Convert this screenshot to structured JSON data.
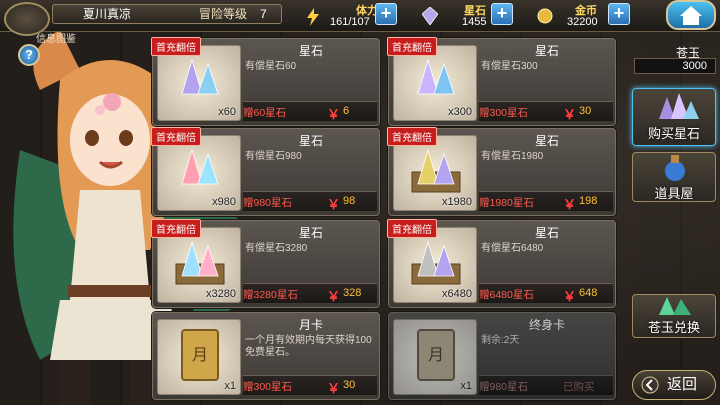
{
  "player": {
    "name": "夏川真凉",
    "level_label": "冒险等级",
    "level": "7"
  },
  "info_label": "信息图鉴",
  "help": "?",
  "resources": [
    {
      "label": "体力",
      "value": "161/107",
      "color": "#ffd866"
    },
    {
      "label": "星石",
      "value": "1455"
    },
    {
      "label": "金币",
      "value": "32200"
    }
  ],
  "plus": "+",
  "products": [
    {
      "badge": "首充翻倍",
      "title": "星石",
      "desc": "有偿星石60",
      "qty": "x60",
      "bonus": "赠60星石",
      "price": "6"
    },
    {
      "badge": "首充翻倍",
      "title": "星石",
      "desc": "有偿星石300",
      "qty": "x300",
      "bonus": "赠300星石",
      "price": "30"
    },
    {
      "badge": "首充翻倍",
      "title": "星石",
      "desc": "有偿星石980",
      "qty": "x980",
      "bonus": "赠980星石",
      "price": "98"
    },
    {
      "badge": "首充翻倍",
      "title": "星石",
      "desc": "有偿星石1980",
      "qty": "x1980",
      "bonus": "赠1980星石",
      "price": "198"
    },
    {
      "badge": "首充翻倍",
      "title": "星石",
      "desc": "有偿星石3280",
      "qty": "x3280",
      "bonus": "赠3280星石",
      "price": "328"
    },
    {
      "badge": "首充翻倍",
      "title": "星石",
      "desc": "有偿星石6480",
      "qty": "x6480",
      "bonus": "赠6480星石",
      "price": "648"
    },
    {
      "title": "月卡",
      "desc": "一个月有效期内每天获得100免费星石。",
      "qty": "x1",
      "bonus": "赠300星石",
      "price": "30"
    },
    {
      "title": "终身卡",
      "desc": "剩余:2天",
      "qty": "x1",
      "bonus": "赠980星石",
      "status": "已购买"
    }
  ],
  "yen": "￥",
  "sidebar": {
    "cangyu_label": "苍玉",
    "cangyu_value": "3000",
    "buy_stone": "购买星石",
    "item_shop": "道具屋",
    "exchange": "苍玉兑换",
    "back": "返回"
  }
}
